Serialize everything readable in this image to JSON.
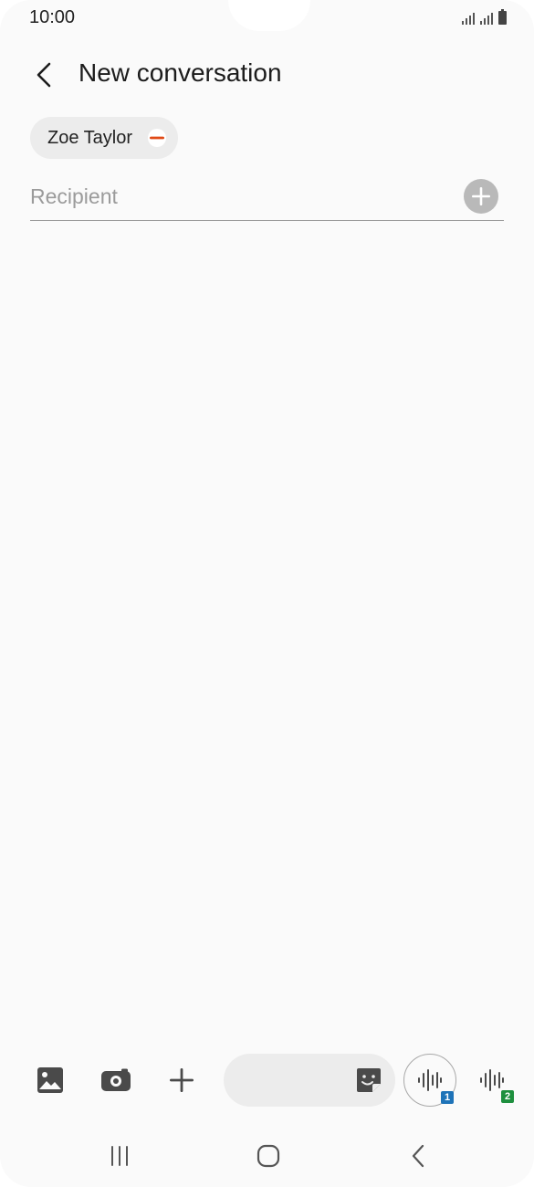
{
  "status_bar": {
    "time": "10:00"
  },
  "header": {
    "title": "New conversation"
  },
  "recipients": {
    "chips": [
      {
        "name": "Zoe Taylor"
      }
    ],
    "placeholder": "Recipient"
  },
  "compose": {
    "sim1_label": "1",
    "sim2_label": "2"
  },
  "colors": {
    "remove_accent": "#e04a16",
    "sim1": "#1e73b8",
    "sim2": "#1e8f3e"
  },
  "icons": {
    "back": "back-arrow-icon",
    "remove": "minus-circle-icon",
    "add": "plus-circle-icon",
    "gallery": "gallery-icon",
    "camera": "camera-icon",
    "attach": "plus-icon",
    "sticker": "sticker-icon",
    "voice": "voice-waveform-icon"
  }
}
